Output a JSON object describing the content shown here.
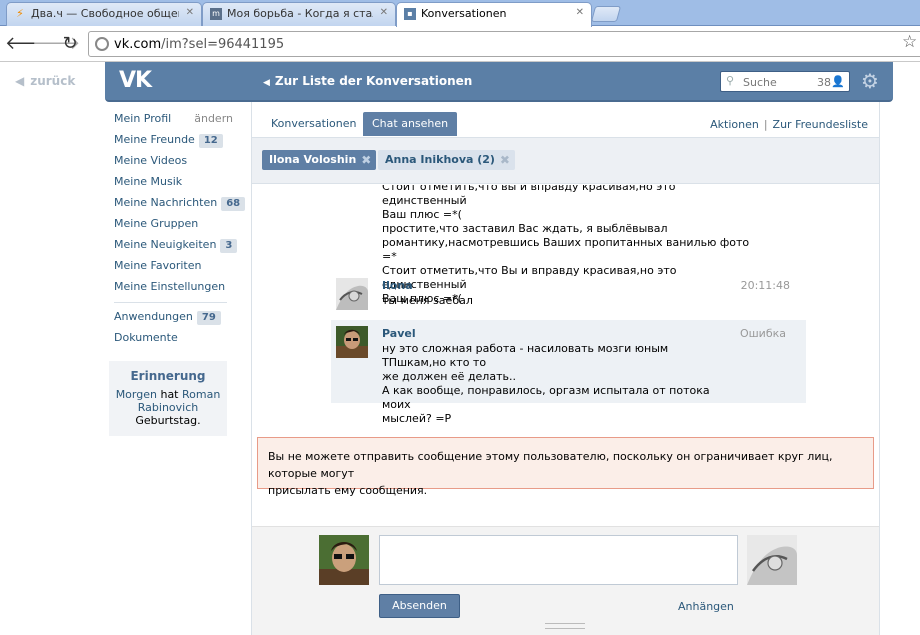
{
  "browser": {
    "tabs": [
      {
        "label": "Два.ч — Свободное общени",
        "favicon": "bolt-icon",
        "active": false
      },
      {
        "label": "Моя борьба - Когда я стал г",
        "favicon": "tv-icon",
        "active": false
      },
      {
        "label": "Konversationen",
        "favicon": "vk-chat-icon",
        "active": true
      }
    ],
    "url_host": "vk.com",
    "url_path": "/im?sel=96441195"
  },
  "page": {
    "back_label": "zurück",
    "header_back_label": "Zur Liste der Konversationen",
    "logo_text": "VK",
    "search": {
      "placeholder": "Suche",
      "count": "38"
    }
  },
  "sidebar": {
    "items": [
      {
        "label": "Mein Profil",
        "extra": "ändern",
        "badge": ""
      },
      {
        "label": "Meine Freunde",
        "badge": "12"
      },
      {
        "label": "Meine Videos",
        "badge": ""
      },
      {
        "label": "Meine Musik",
        "badge": ""
      },
      {
        "label": "Meine Nachrichten",
        "badge": "68"
      },
      {
        "label": "Meine Gruppen",
        "badge": ""
      },
      {
        "label": "Meine Neuigkeiten",
        "badge": "3"
      },
      {
        "label": "Meine Favoriten",
        "badge": ""
      },
      {
        "label": "Meine Einstellungen",
        "badge": ""
      },
      {
        "label": "Anwendungen",
        "badge": "79"
      },
      {
        "label": "Dokumente",
        "badge": ""
      }
    ],
    "reminder": {
      "title": "Erinnerung",
      "w1": "Morgen",
      "w2": "hat",
      "name": "Roman Rabinovich",
      "tail": "Geburtstag."
    }
  },
  "main": {
    "tabs": [
      "Konversationen",
      "Chat ansehen"
    ],
    "links": [
      "Aktionen",
      "Zur Freundesliste"
    ],
    "participants": [
      {
        "name": "Ilona Voloshin",
        "active": true
      },
      {
        "name": "Anna Inikhova (2)",
        "active": false
      }
    ],
    "history_tail": [
      "Стоит отметить,что вы и вправду красивая,но это единственный",
      "Ваш плюс =*(",
      "простите,что заставил Вас ждать, я выблёвывал",
      "романтику,насмотревшись Ваших пропитанных ванилью фото =*",
      "Стоит отметить,что Вы и вправду красивая,но это единственный",
      "Ваш плюс =*("
    ],
    "messages": [
      {
        "author": "Ilona",
        "time": "20:11:48",
        "lines": [
          "ты меня заебал"
        ]
      },
      {
        "author": "Pavel",
        "time": "Ошибка",
        "lines": [
          "ну это сложная работа - насиловать мозги юным ТПшкам,но кто то",
          "же должен её делать..",
          "А как вообще, понравилось, оргазм испытала от потока моих",
          "мыслей? =P"
        ]
      }
    ],
    "alert_lines": [
      "Вы не можете отправить сообщение этому пользователю, поскольку он ограничивает круг лиц, которые могут",
      "присылать ему сообщения."
    ],
    "composer": {
      "send_label": "Absenden",
      "attach_label": "Anhängen"
    }
  },
  "colors": {
    "header_blue": "#5b7fa6",
    "link": "#2b587a",
    "alert_bg": "#fbeee8",
    "alert_border": "#e89b88"
  }
}
